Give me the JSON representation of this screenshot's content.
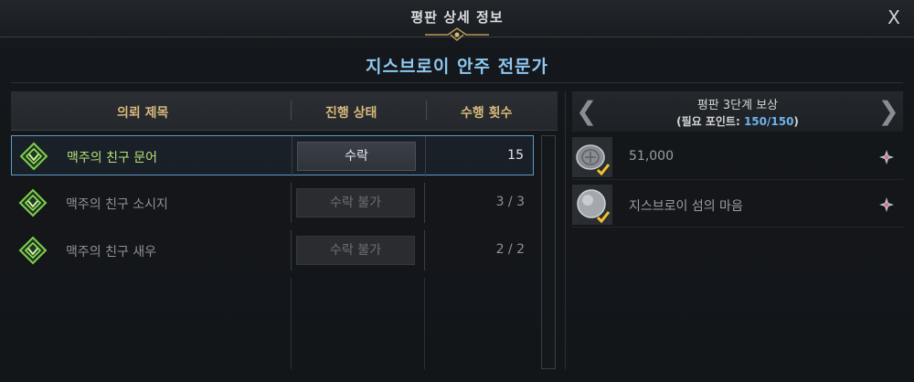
{
  "window": {
    "title": "평판 상세 정보",
    "subtitle": "지스브로이 안주 전문가",
    "close_label": "X"
  },
  "quest_table": {
    "headers": [
      "의뢰 제목",
      "진행 상태",
      "수행 횟수"
    ],
    "rows": [
      {
        "title": "맥주의 친구 문어",
        "status": "수락",
        "count": "15",
        "selected": true,
        "enabled": true
      },
      {
        "title": "맥주의 친구 소시지",
        "status": "수락 불가",
        "count": "3 / 3",
        "selected": false,
        "enabled": false
      },
      {
        "title": "맥주의 친구 새우",
        "status": "수락 불가",
        "count": "2 / 2",
        "selected": false,
        "enabled": false
      }
    ]
  },
  "reward_panel": {
    "title": "평판 3단계 보상",
    "points_label": "(필요 포인트: ",
    "points_value": "150/150",
    "points_close": ")",
    "items": [
      {
        "name": "51,000",
        "icon": "silver-coin-icon"
      },
      {
        "name": "지스브로이 섬의 마음",
        "icon": "island-heart-icon"
      }
    ]
  },
  "colors": {
    "accent_blue": "#8fc7ef",
    "header_gold": "#d8b97a",
    "selected_green": "#b8e07a",
    "quest_icon_green": "#7fcf4a"
  }
}
